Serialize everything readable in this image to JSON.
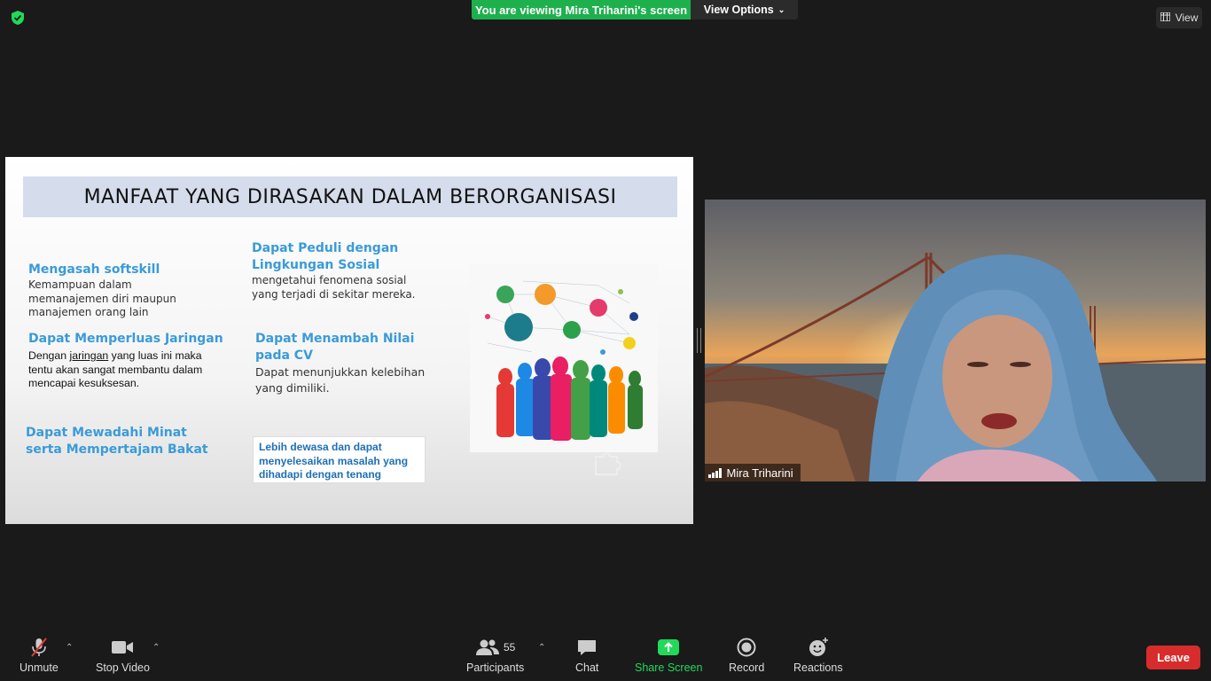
{
  "window": {
    "viewing_banner": "You are viewing Mira Triharini's screen",
    "view_options_label": "View Options",
    "view_label": "View",
    "security_icon": "shield-check-icon"
  },
  "slide": {
    "title": "MANFAAT YANG DIRASAKAN DALAM BERORGANISASI",
    "blocks": [
      {
        "heading": "Mengasah softskill",
        "body": [
          "Kemampuan dalam",
          "memanajemen diri maupun",
          "manajemen orang lain"
        ]
      },
      {
        "heading": "Dapat Memperluas Jaringan",
        "body_before": "Dengan ",
        "body_link": "jaringan",
        "body_after": " yang luas ini maka",
        "body_rest": [
          "tentu akan sangat membantu  dalam",
          "mencapai kesuksesan."
        ]
      },
      {
        "heading": "Dapat Mewadahi Minat",
        "heading2": "serta Mempertajam Bakat"
      },
      {
        "heading": "Dapat Peduli dengan",
        "heading2": "Lingkungan Sosial",
        "body": [
          "mengetahui fenomena sosial",
          "yang terjadi di sekitar mereka."
        ]
      },
      {
        "heading": "Dapat Menambah Nilai",
        "heading2": "pada CV",
        "body": [
          "Dapat menunjukkan kelebihan",
          "yang dimiliki."
        ]
      },
      {
        "box": [
          "Lebih dewasa dan dapat",
          "menyelesaikan masalah yang",
          "dihadapi dengan tenang"
        ]
      }
    ]
  },
  "video": {
    "participant_name": "Mira Triharini"
  },
  "toolbar": {
    "unmute": "Unmute",
    "stop_video": "Stop Video",
    "participants": "Participants",
    "participants_count": "55",
    "chat": "Chat",
    "share_screen": "Share Screen",
    "record": "Record",
    "reactions": "Reactions",
    "leave": "Leave"
  },
  "colors": {
    "banner_green": "#1fb04e",
    "share_green": "#23d959",
    "leave_red": "#d82c2c",
    "slide_heading_blue": "#3a9bd8"
  }
}
